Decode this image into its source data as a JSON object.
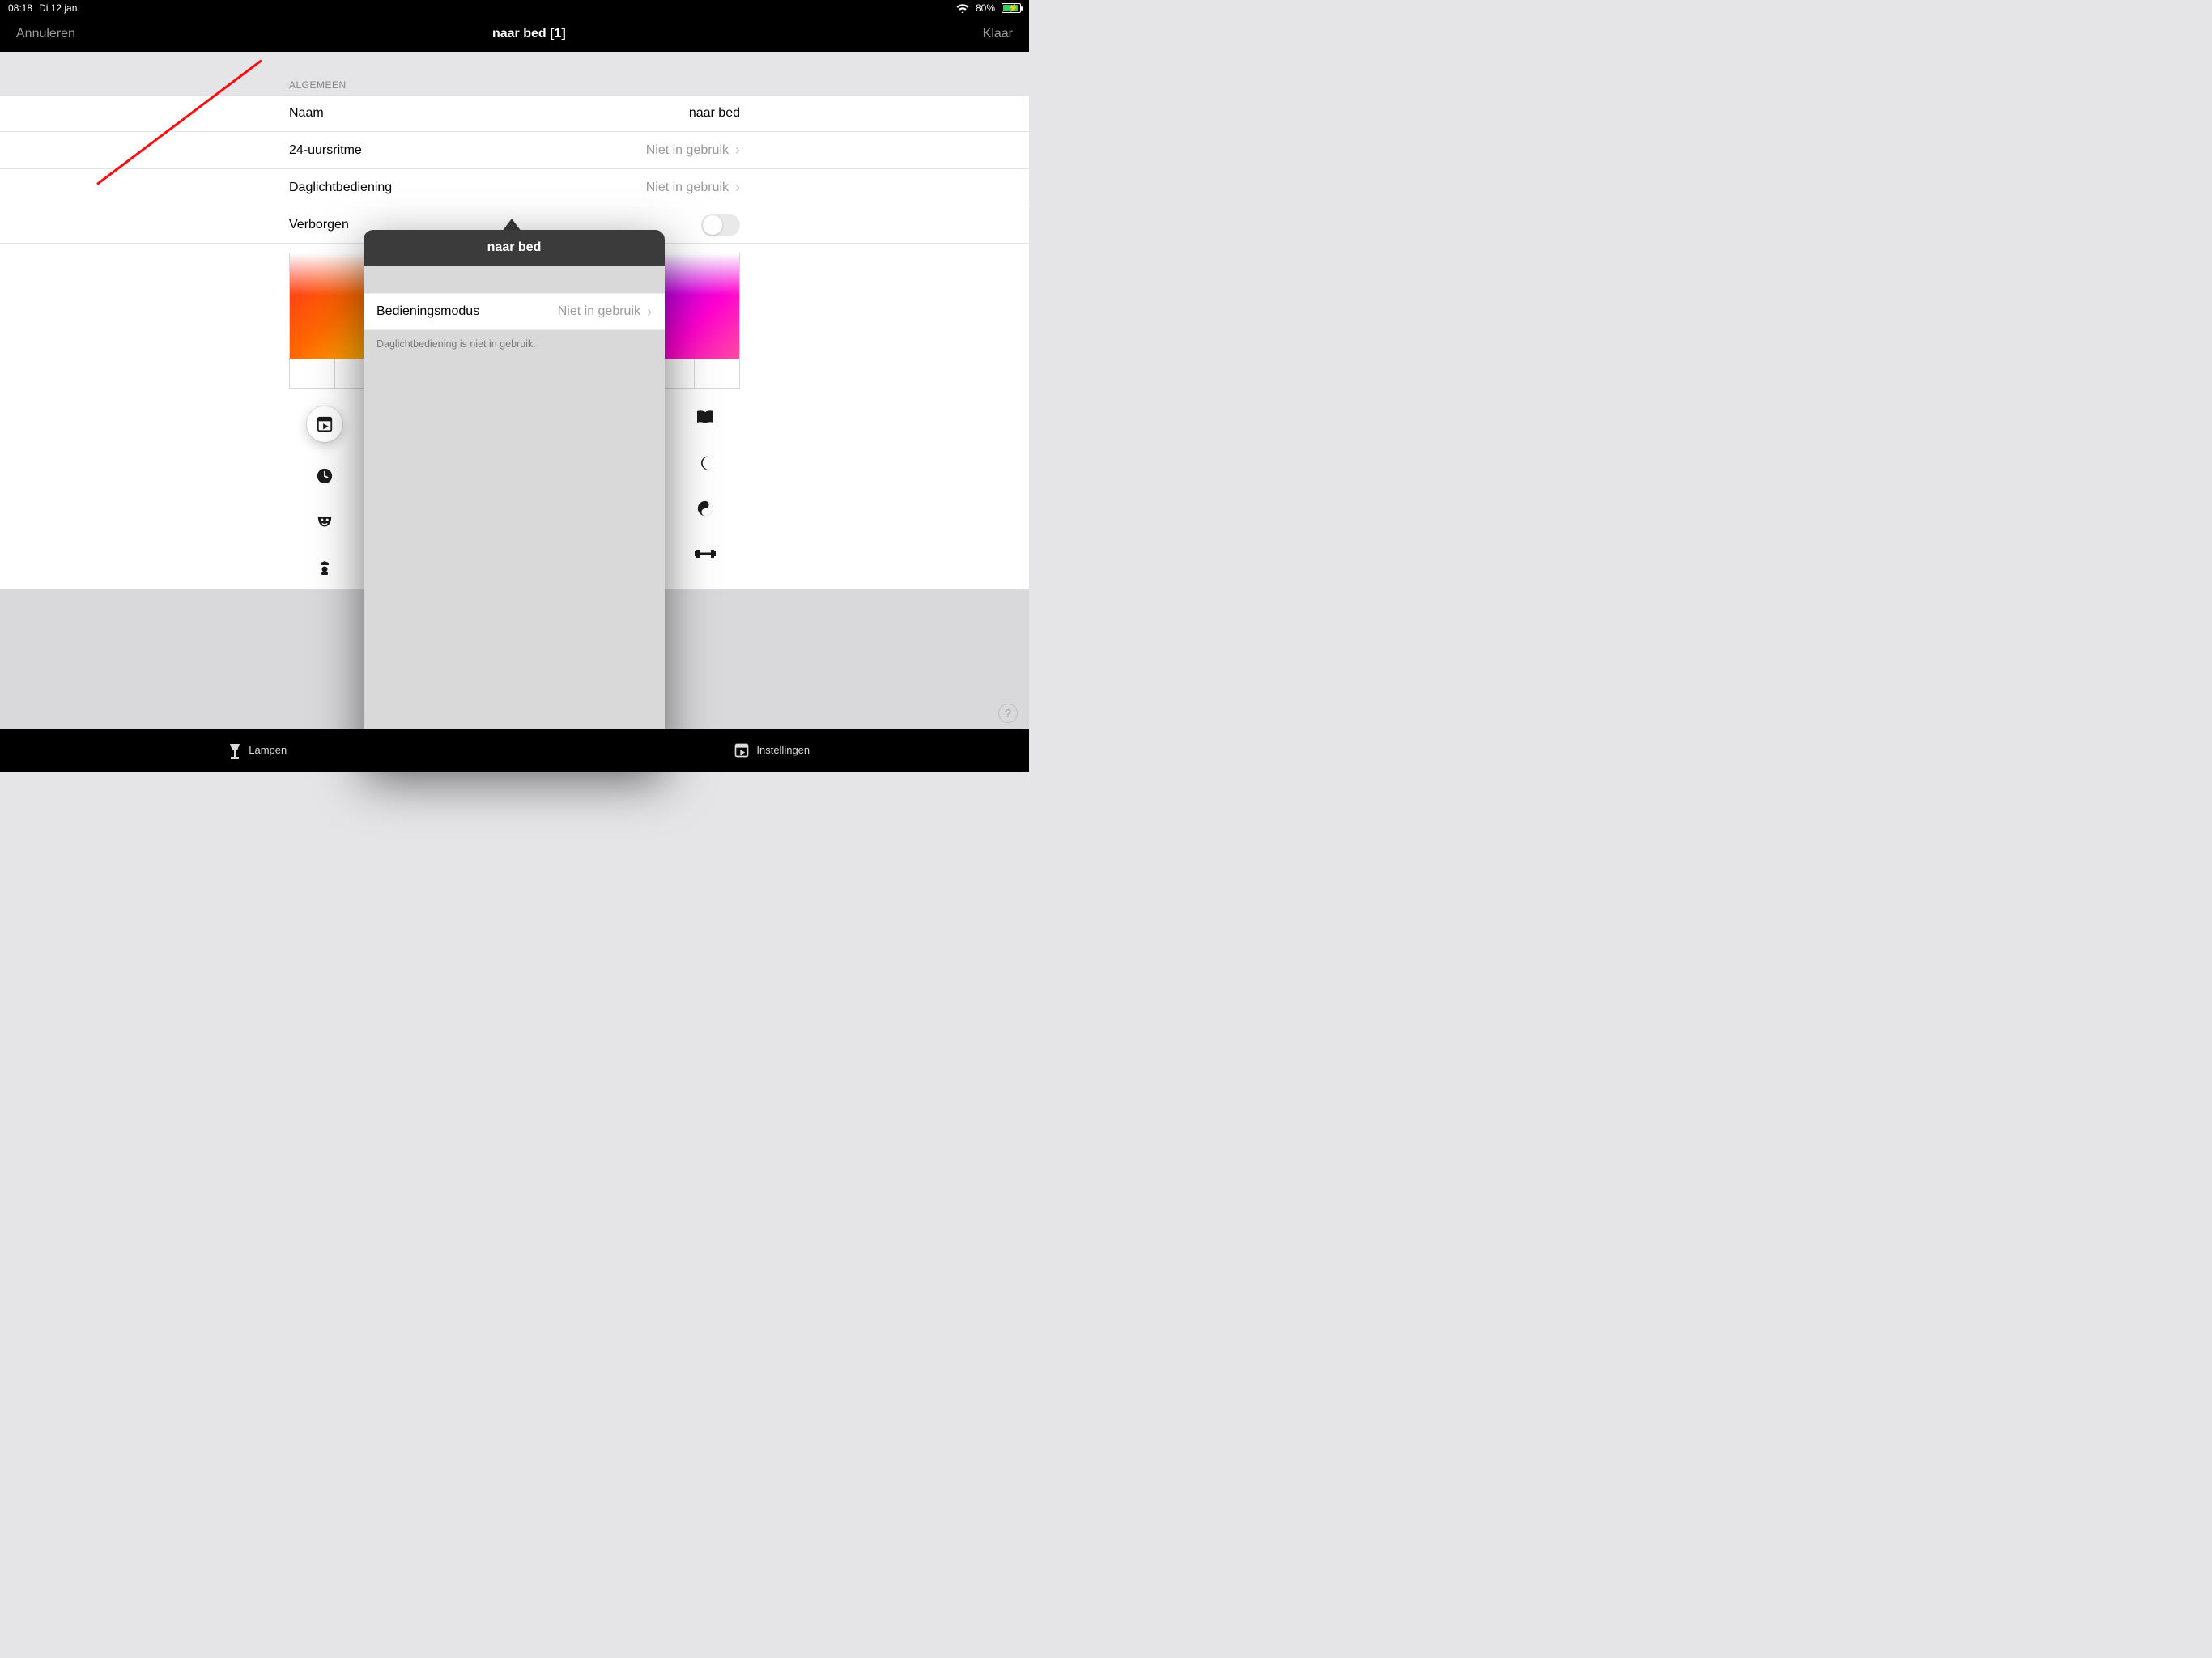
{
  "statusbar": {
    "time": "08:18",
    "date": "Di 12 jan.",
    "battery_pct": "80%"
  },
  "navbar": {
    "cancel": "Annuleren",
    "title": "naar bed [1]",
    "done": "Klaar"
  },
  "section": {
    "header": "ALGEMEEN"
  },
  "rows": {
    "name_label": "Naam",
    "name_value": "naar bed",
    "circadian_label": "24-uursritme",
    "circadian_value": "Niet in gebruik",
    "daylight_label": "Daglichtbediening",
    "daylight_value": "Niet in gebruik",
    "hidden_label": "Verborgen"
  },
  "popover": {
    "title": "naar bed",
    "row_label": "Bedieningsmodus",
    "row_value": "Niet in gebruik",
    "footer": "Daglichtbediening is niet in gebruik."
  },
  "tabs": {
    "lampen": "Lampen",
    "instellingen": "Instellingen"
  },
  "icons": {
    "scene": "scene-icon",
    "clock": "clock-icon",
    "mask": "mask-icon",
    "chef": "chef-icon",
    "book": "book-icon",
    "moon": "moon-icon",
    "yinyang": "yinyang-icon",
    "dumbbell": "dumbbell-icon"
  }
}
